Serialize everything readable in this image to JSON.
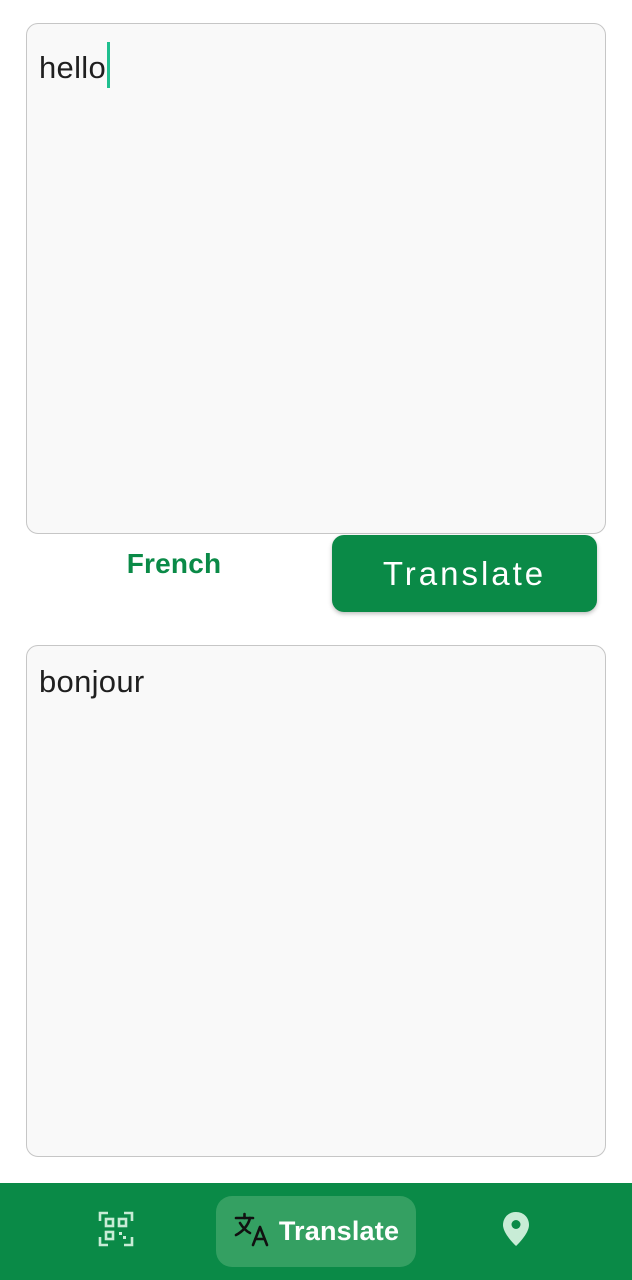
{
  "input": {
    "value": "hello"
  },
  "controls": {
    "target_language": "French",
    "translate_button_label": "Translate"
  },
  "output": {
    "value": "bonjour"
  },
  "bottom_nav": {
    "items": [
      {
        "icon": "qr-scan-icon",
        "label": ""
      },
      {
        "icon": "translate-icon",
        "label": "Translate",
        "selected": true
      },
      {
        "icon": "location-pin-icon",
        "label": ""
      }
    ]
  },
  "colors": {
    "primary_green": "#0a8a47",
    "nav_selected_pill": "#34a062",
    "cursor": "#1fbf8f",
    "box_background": "#f9f9f9",
    "box_border": "#c6c6c6",
    "icon_inactive": "#c8ecd6"
  }
}
